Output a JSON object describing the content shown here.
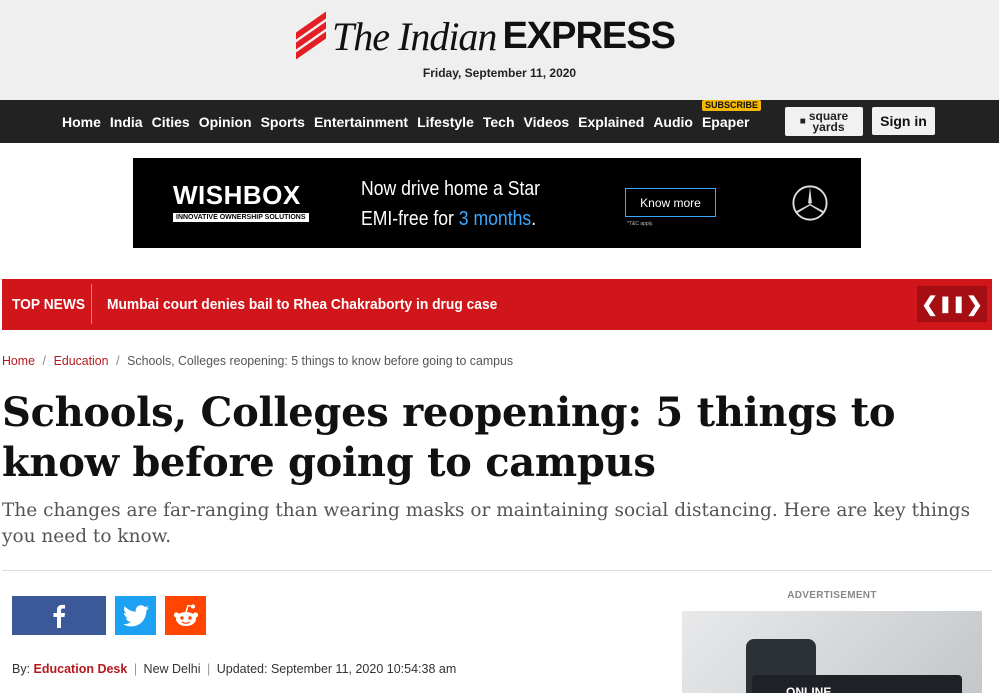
{
  "masthead": {
    "logo_text_the_indian": "The Indian",
    "logo_text_express": "EXPRESS",
    "date": "Friday, September 11, 2020"
  },
  "nav": {
    "items": [
      "Home",
      "India",
      "Cities",
      "Opinion",
      "Sports",
      "Entertainment",
      "Lifestyle",
      "Tech",
      "Videos",
      "Explained",
      "Audio"
    ],
    "epaper": "Epaper",
    "subscribe_tag": "SUBSCRIBE",
    "squareyards_line1": "square",
    "squareyards_line2": "yards",
    "signin": "Sign in"
  },
  "ad_banner": {
    "brand": "WISHBOX",
    "brand_sub": "INNOVATIVE OWNERSHIP SOLUTIONS",
    "headline_line1": "Now drive home a Star",
    "headline_line2_prefix": "EMI-free for ",
    "headline_line2_accent": "3 months",
    "headline_line2_suffix": ".",
    "cta": "Know more",
    "tc": "*T&C apply."
  },
  "top_news": {
    "label": "TOP NEWS",
    "headline": "Mumbai court denies bail to Rhea Chakraborty in drug case",
    "prev": "❮",
    "pause": "❚❚",
    "next": "❯"
  },
  "breadcrumb": {
    "home": "Home",
    "section": "Education",
    "current": "Schools, Colleges reopening: 5 things to know before going to campus",
    "separator": "/"
  },
  "article": {
    "title": "Schools, Colleges reopening: 5 things to know before going to campus",
    "synopsis": "The changes are far-ranging than wearing masks or maintaining social distancing. Here are key things you need to know.",
    "byline_prefix": "By:",
    "author": "Education Desk",
    "location": "New Delhi",
    "updated": "Updated: September 11, 2020 10:54:38 am"
  },
  "social": {
    "facebook_icon": "facebook-icon",
    "twitter_icon": "twitter-icon",
    "reddit_icon": "reddit-icon",
    "facebook_color": "#3b5998",
    "twitter_color": "#1da1f2",
    "reddit_color": "#ff4500"
  },
  "sidebar": {
    "ad_label": "ADVERTISEMENT",
    "ad_screen_text": "ONLINE"
  },
  "colors": {
    "brand_red": "#d0151b",
    "nav_bg": "#222222",
    "link_red": "#b6191e"
  }
}
